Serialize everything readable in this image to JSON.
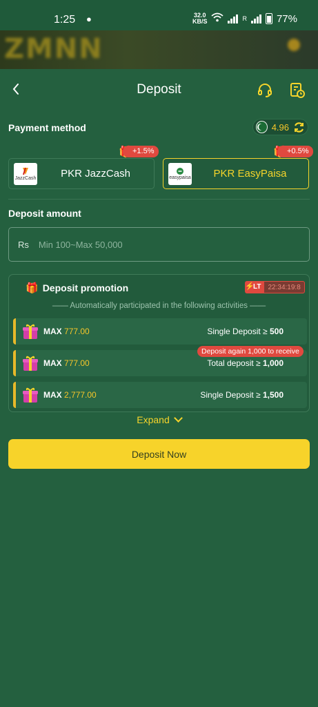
{
  "status_bar": {
    "time": "1:25",
    "speed_value": "32.0",
    "speed_unit": "KB/S",
    "roaming": "R",
    "battery": "77%"
  },
  "header": {
    "title": "Deposit"
  },
  "payment": {
    "label": "Payment method",
    "balance": "4.96",
    "methods": [
      {
        "name": "PKR JazzCash",
        "bonus": "+1.5%",
        "logo_text": "JazzCash",
        "selected": false
      },
      {
        "name": "PKR EasyPaisa",
        "bonus": "+0.5%",
        "logo_text": "easypaisa",
        "selected": true
      }
    ]
  },
  "amount": {
    "label": "Deposit amount",
    "currency": "Rs",
    "placeholder": "Min 100~Max 50,000"
  },
  "promotion": {
    "title": "Deposit promotion",
    "timer_label": "LT",
    "timer_value": "22:34:19:8",
    "subtitle": "—— Automatically participated in the following activities ——",
    "again_tag": "Deposit again 1,000 to receive",
    "rows": [
      {
        "max_label": "MAX",
        "amount": "777.00",
        "condition": "Single Deposit ≥ ",
        "threshold": "500"
      },
      {
        "max_label": "MAX",
        "amount": "777.00",
        "condition": "Total deposit ≥ ",
        "threshold": "1,000"
      },
      {
        "max_label": "MAX",
        "amount": "2,777.00",
        "condition": "Single Deposit ≥ ",
        "threshold": "1,500"
      }
    ]
  },
  "expand_label": "Expand",
  "deposit_button": "Deposit Now",
  "colors": {
    "background": "#24603f",
    "accent": "#f7d32a",
    "badge": "#e0493f"
  }
}
